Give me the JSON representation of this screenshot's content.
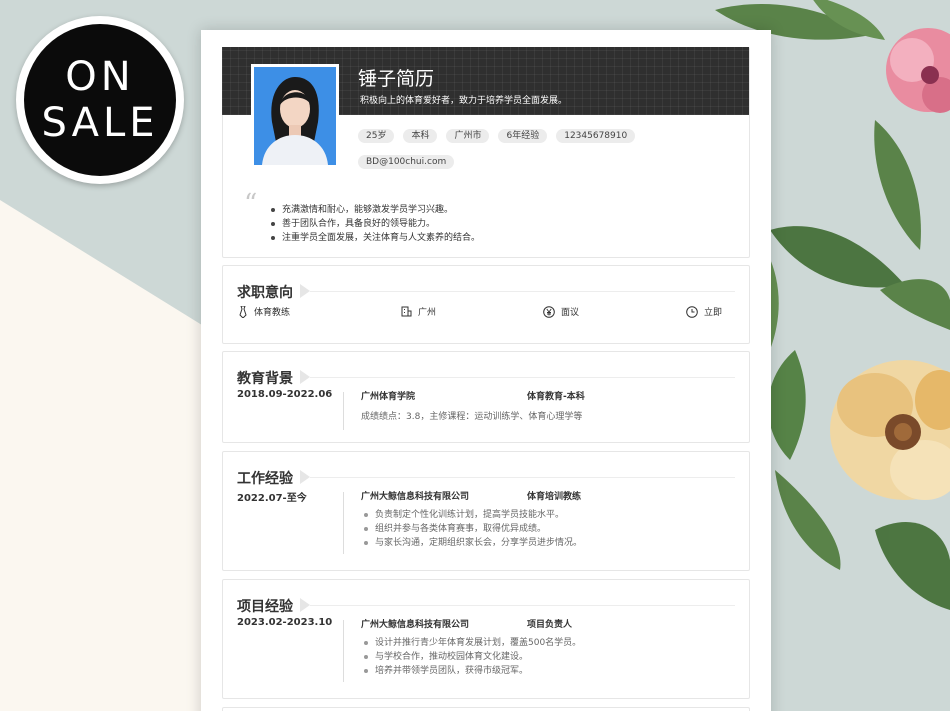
{
  "badge": {
    "line1": "ON",
    "line2": "SALE"
  },
  "resume": {
    "name": "锤子简历",
    "tagline": "积极向上的体育爱好者，致力于培养学员全面发展。",
    "tags": [
      "25岁",
      "本科",
      "广州市",
      "6年经验",
      "12345678910",
      "BD@100chui.com"
    ],
    "summary": [
      "充满激情和耐心，能够激发学员学习兴趣。",
      "善于团队合作，具备良好的领导能力。",
      "注重学员全面发展，关注体育与人文素养的结合。"
    ]
  },
  "intent": {
    "title": "求职意向",
    "items": [
      {
        "icon": "tie-icon",
        "label": "体育教练"
      },
      {
        "icon": "building-icon",
        "label": "广州"
      },
      {
        "icon": "yen-icon",
        "label": "面议"
      },
      {
        "icon": "clock-icon",
        "label": "立即"
      }
    ]
  },
  "education": {
    "title": "教育背景",
    "date": "2018.09-2022.06",
    "school": "广州体育学院",
    "major": "体育教育-本科",
    "detail": "成绩绩点：3.8，主修课程：运动训练学、体育心理学等"
  },
  "work": {
    "title": "工作经验",
    "date": "2022.07-至今",
    "company": "广州大鲸信息科技有限公司",
    "role": "体育培训教练",
    "bullets": [
      "负责制定个性化训练计划，提高学员技能水平。",
      "组织并参与各类体育赛事，取得优异成绩。",
      "与家长沟通，定期组织家长会，分享学员进步情况。"
    ]
  },
  "project": {
    "title": "项目经验",
    "date": "2023.02-2023.10",
    "company": "广州大鲸信息科技有限公司",
    "role": "项目负责人",
    "bullets": [
      "设计并推行青少年体育发展计划，覆盖500名学员。",
      "与学校合作，推动校园体育文化建设。",
      "培养并带领学员团队，获得市级冠军。"
    ]
  },
  "colors": {
    "header": "#2f2f2f",
    "background": "#cdd8d6",
    "cream": "#fbf7f0"
  }
}
